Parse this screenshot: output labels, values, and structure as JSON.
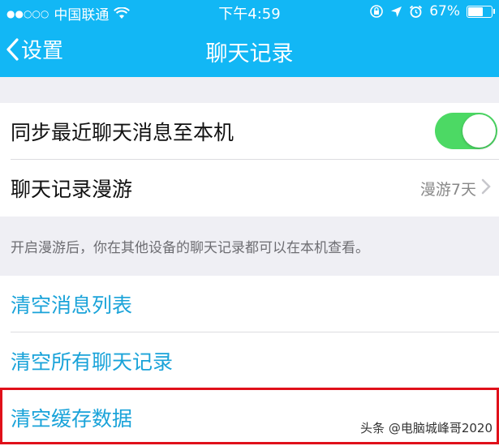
{
  "status_bar": {
    "signal_dots": "●●○○○",
    "carrier": "中国联通",
    "time": "下午4:59",
    "battery": "67%",
    "battery_level": 0.67
  },
  "nav": {
    "back_label": "设置",
    "title": "聊天记录"
  },
  "settings": {
    "sync_label": "同步最近聊天消息至本机",
    "sync_enabled": true,
    "roam_label": "聊天记录漫游",
    "roam_value": "漫游7天",
    "roam_note": "开启漫游后，你在其他设备的聊天记录都可以在本机查看。"
  },
  "actions": {
    "clear_list": "清空消息列表",
    "clear_all": "清空所有聊天记录",
    "clear_cache": "清空缓存数据"
  },
  "watermark": "头条 @电脑城峰哥2020",
  "colors": {
    "nav_bg": "#12b7f5",
    "toggle_on": "#4cd964",
    "action_text": "#1aa3d9",
    "highlight": "#e0101a"
  }
}
